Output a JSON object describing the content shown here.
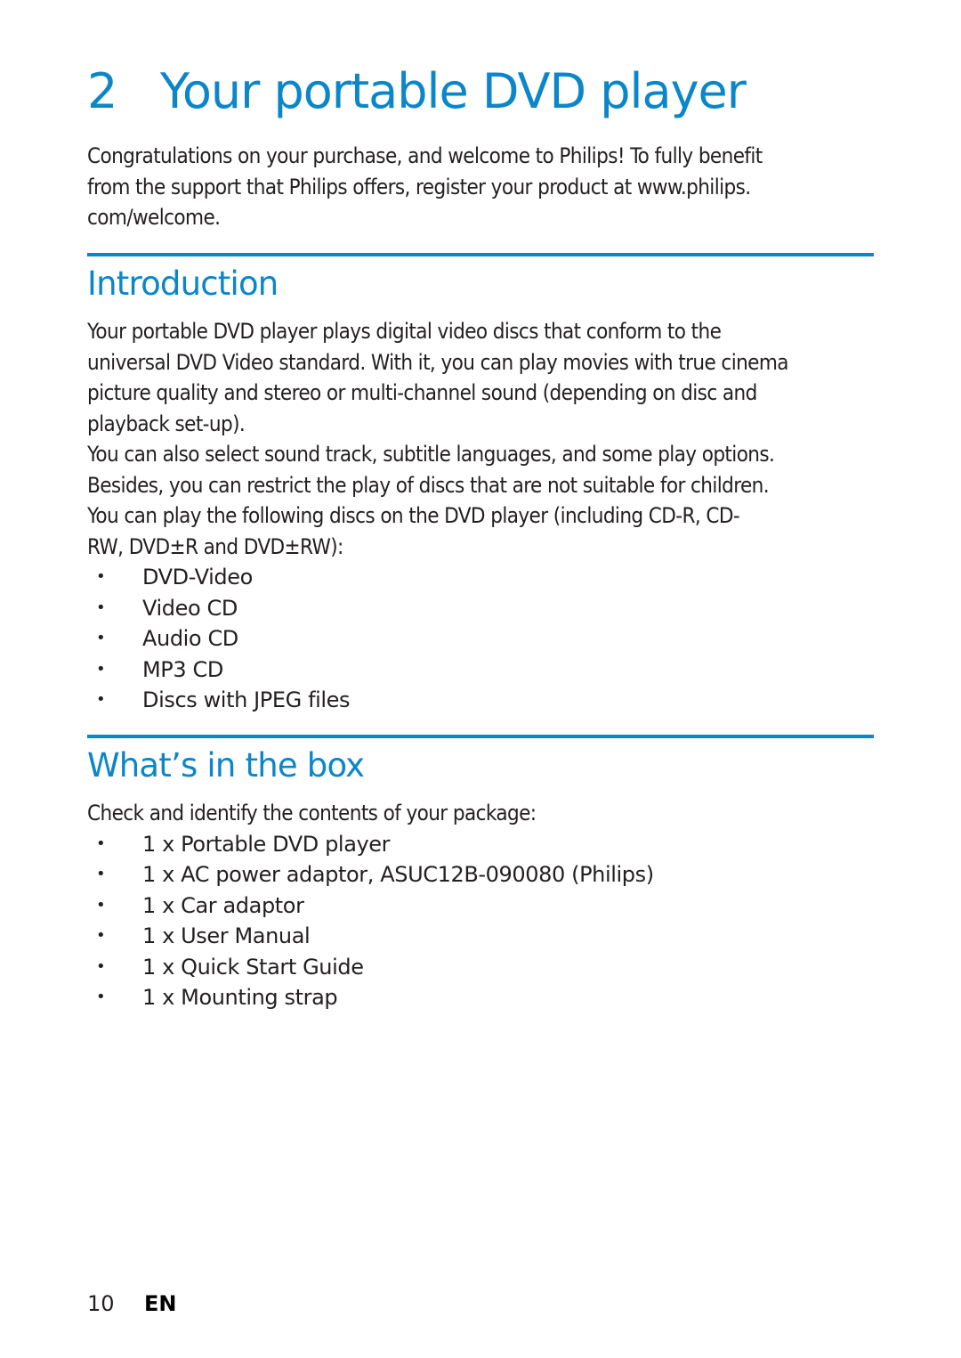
{
  "chapter": {
    "number": "2",
    "title": "Your portable DVD player"
  },
  "intro_paragraph": "Congratulations on your purchase, and welcome to Philips! To fully benefit from the support that Philips offers, register your product at www.philips.com/welcome.",
  "intro_lines": [
    "Congratulations on your purchase, and welcome to Philips! To fully benefit",
    "from the support that Philips offers, register your product at www.philips.",
    "com/welcome."
  ],
  "sections": {
    "introduction": {
      "title": "Introduction",
      "paragraph_lines": [
        "Your portable DVD player plays digital video discs that conform to the",
        "universal DVD Video standard. With it, you can play movies with true cinema",
        "picture quality and stereo or multi-channel sound (depending on disc and",
        "playback set-up).",
        "You can also select sound track, subtitle languages, and some play options.",
        "Besides, you can restrict the play of discs that are not suitable for children.",
        "You can play the following discs on the DVD player (including CD-R, CD-",
        "RW, DVD±R and DVD±RW):"
      ],
      "disc_types": [
        "DVD-Video",
        "Video CD",
        "Audio CD",
        "MP3 CD",
        "Discs with JPEG files"
      ]
    },
    "whats_in_the_box": {
      "title": "What’s in the box",
      "lead": "Check and identify the contents of your package:",
      "items": [
        "1 x Portable DVD player",
        "1 x AC power adaptor, ASUC12B-090080 (Philips)",
        "1 x Car adaptor",
        "1 x User Manual",
        "1 x Quick Start Guide",
        "1 x Mounting strap"
      ]
    }
  },
  "bullet_glyph": "•",
  "footer": {
    "page_number": "10",
    "language": "EN"
  },
  "colors": {
    "accent": "#0b86c8",
    "text": "#231f20"
  }
}
